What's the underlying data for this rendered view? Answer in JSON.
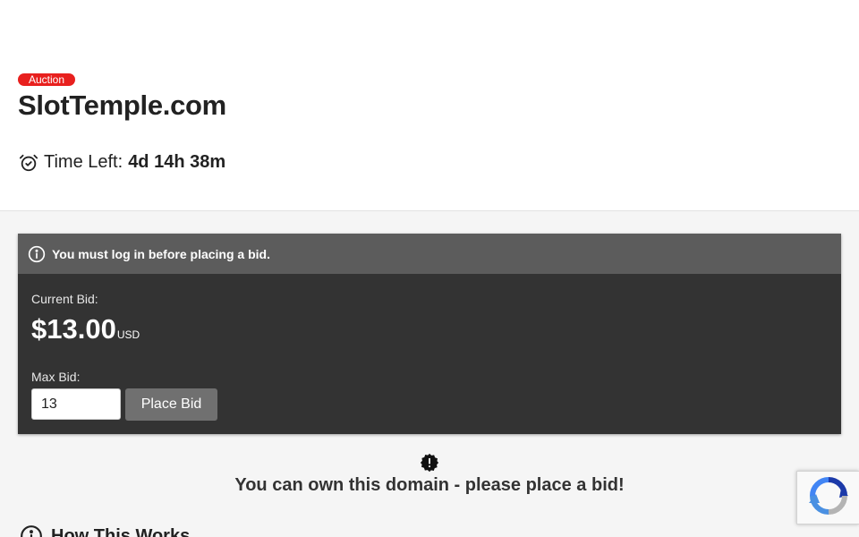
{
  "listing": {
    "badge": "Auction",
    "domain": "SlotTemple.com",
    "time_left_label": "Time Left:",
    "time_left_value": "4d 14h 38m"
  },
  "bid_panel": {
    "notice": "You must log in before placing a bid.",
    "current_bid_label": "Current Bid:",
    "current_bid_amount": "$13.00",
    "currency": "USD",
    "max_bid_label": "Max Bid:",
    "max_bid_value": "13",
    "place_bid_label": "Place Bid"
  },
  "own_notice": {
    "text": "You can own this domain - please place a bid!"
  },
  "how_it_works": {
    "heading": "How This Works"
  },
  "icons": {
    "clock": "alarm-clock-icon",
    "info": "info-circle-icon",
    "burst": "exclamation-badge-icon",
    "recaptcha": "recaptcha-logo-icon"
  },
  "colors": {
    "badge": "#e8201e",
    "panel": "#333333",
    "notice_bar": "#5c5c5c",
    "button": "#707070"
  }
}
